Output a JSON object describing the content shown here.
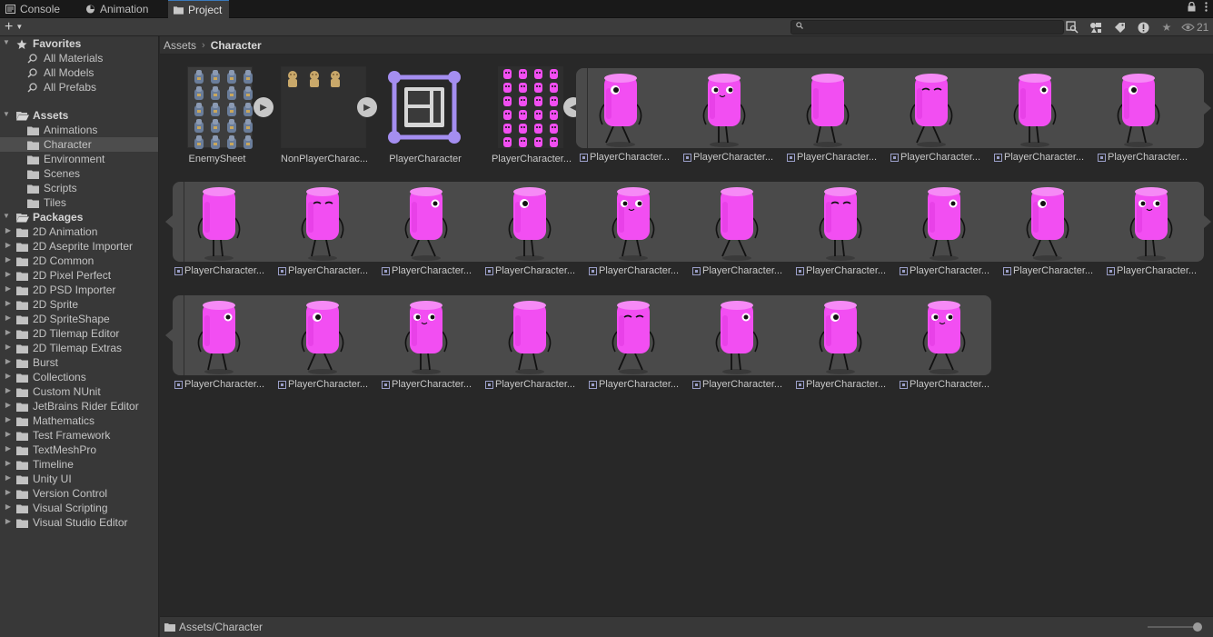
{
  "tabs": [
    {
      "label": "Console",
      "icon": "console-icon"
    },
    {
      "label": "Animation",
      "icon": "animation-icon"
    },
    {
      "label": "Project",
      "icon": "folder-icon",
      "active": true
    }
  ],
  "toolbar": {
    "add_label": "+",
    "search_placeholder": "",
    "visible_count": "21"
  },
  "sidebar": {
    "favorites_label": "Favorites",
    "favorites": [
      "All Materials",
      "All Models",
      "All Prefabs"
    ],
    "assets_label": "Assets",
    "assets": [
      "Animations",
      "Character",
      "Environment",
      "Scenes",
      "Scripts",
      "Tiles"
    ],
    "selected_asset": "Character",
    "packages_label": "Packages",
    "packages": [
      "2D Animation",
      "2D Aseprite Importer",
      "2D Common",
      "2D Pixel Perfect",
      "2D PSD Importer",
      "2D Sprite",
      "2D SpriteShape",
      "2D Tilemap Editor",
      "2D Tilemap Extras",
      "Burst",
      "Collections",
      "Custom NUnit",
      "JetBrains Rider Editor",
      "Mathematics",
      "Test Framework",
      "TextMeshPro",
      "Timeline",
      "Unity UI",
      "Version Control",
      "Visual Scripting",
      "Visual Studio Editor"
    ]
  },
  "breadcrumb": {
    "root": "Assets",
    "current": "Character"
  },
  "main_assets": [
    {
      "label": "EnemySheet"
    },
    {
      "label": "NonPlayerCharac..."
    },
    {
      "label": "PlayerCharacter"
    },
    {
      "label": "PlayerCharacter..."
    }
  ],
  "subasset_label": "PlayerCharacter...",
  "accent": {
    "pink": "#f24ef2",
    "purple": "#a48ef0"
  },
  "footer": {
    "path": "Assets/Character"
  }
}
